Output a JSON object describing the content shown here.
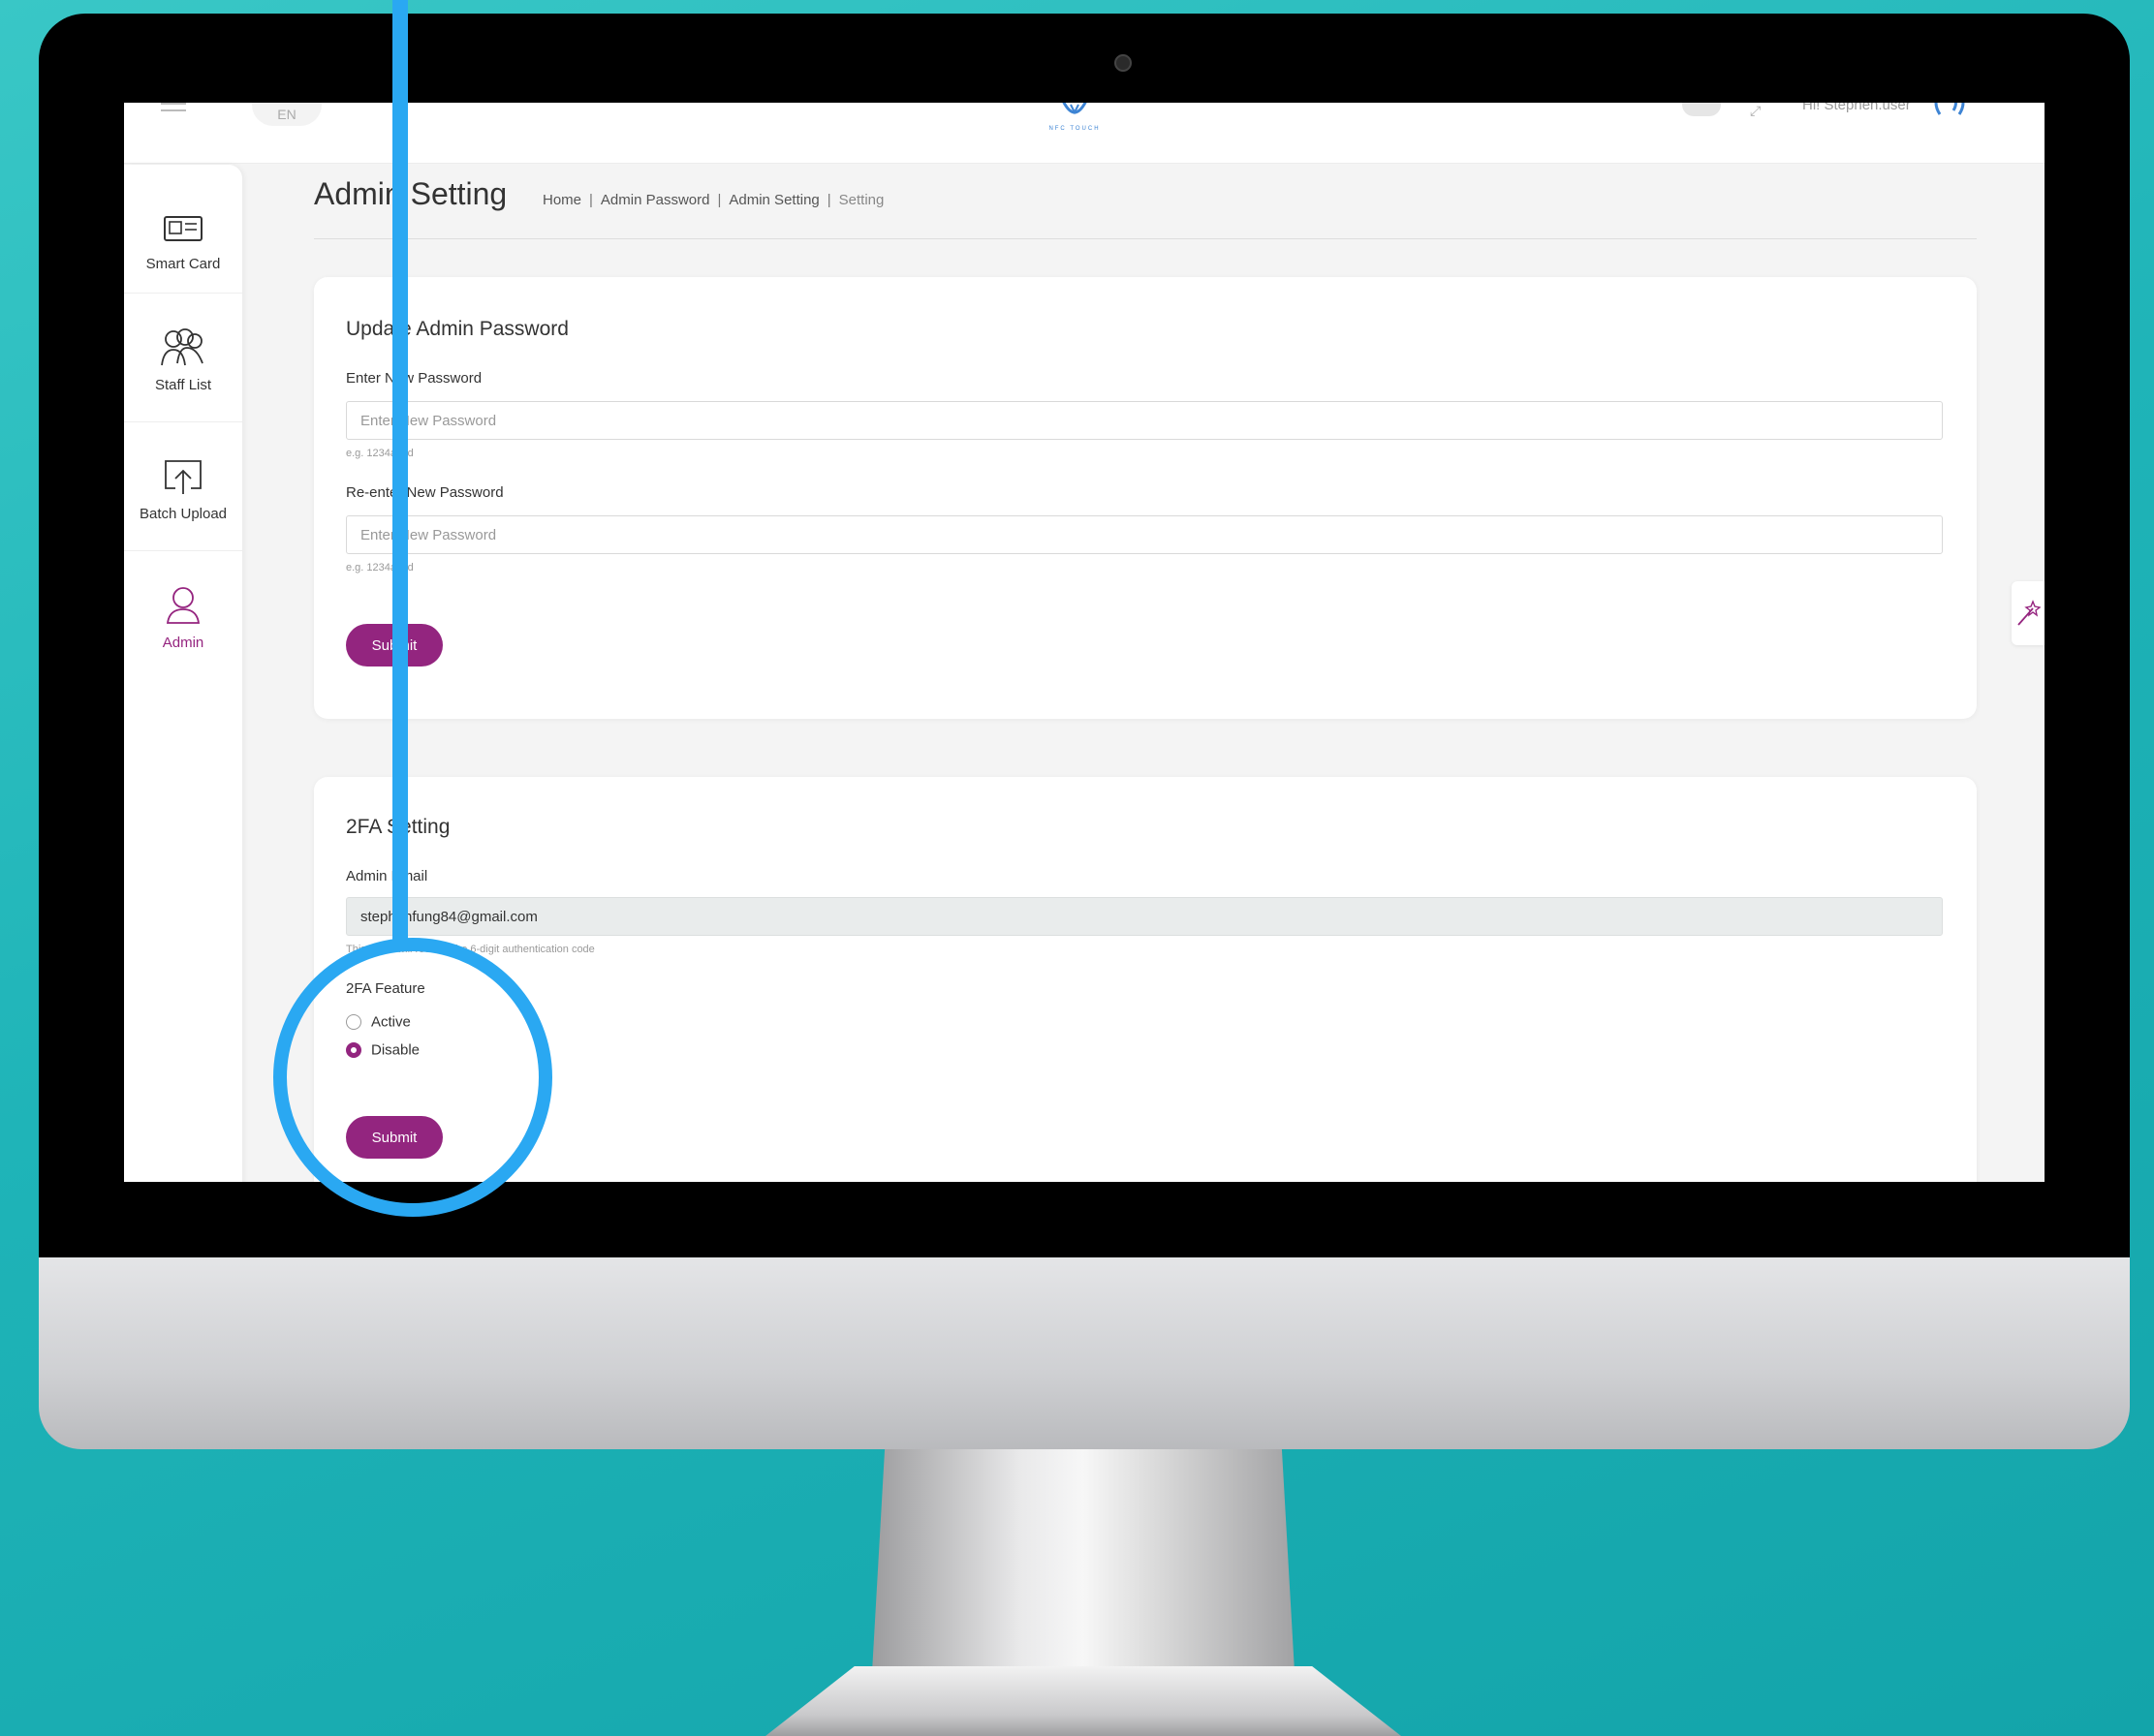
{
  "topbar": {
    "language": "EN",
    "logo_text": "NFC TOUCH",
    "greeting": "Hi! Stephen.user"
  },
  "sidebar": {
    "items": [
      {
        "label": "Smart Card",
        "icon": "smart-card-icon"
      },
      {
        "label": "Staff List",
        "icon": "staff-list-icon"
      },
      {
        "label": "Batch Upload",
        "icon": "upload-icon"
      },
      {
        "label": "Admin",
        "icon": "admin-user-icon",
        "active": true
      }
    ]
  },
  "page": {
    "title": "Admin Setting",
    "breadcrumb": [
      "Home",
      "Admin Password",
      "Admin Setting",
      "Setting"
    ]
  },
  "password_card": {
    "title": "Update Admin Password",
    "new_password_label": "Enter New Password",
    "new_password_placeholder": "Enter New Password",
    "new_password_value": "",
    "new_password_hint": "e.g. 1234abcd",
    "reenter_label": "Re-enter New Password",
    "reenter_placeholder": "Enter New Password",
    "reenter_value": "",
    "reenter_hint": "e.g. 1234abcd",
    "submit_label": "Submit"
  },
  "twofa_card": {
    "title": "2FA Setting",
    "email_label": "Admin Email",
    "email_value": "stephenfung84@gmail.com",
    "email_hint": "This email will receive the 6-digit authentication code",
    "feature_label": "2FA Feature",
    "options": [
      {
        "label": "Active",
        "checked": false
      },
      {
        "label": "Disable",
        "checked": true
      }
    ],
    "submit_label": "Submit"
  },
  "colors": {
    "accent": "#93257f",
    "annotation": "#2aa8f2",
    "background": "#1fb4b8"
  }
}
